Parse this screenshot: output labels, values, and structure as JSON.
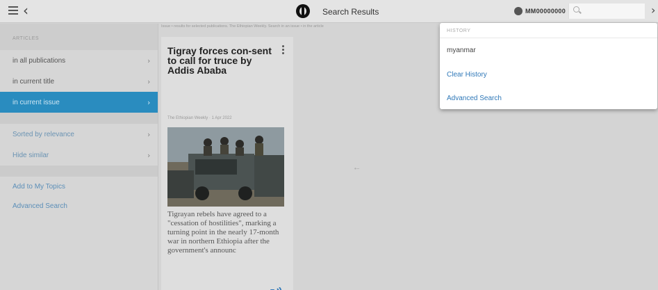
{
  "topbar": {
    "title": "Search Results",
    "user_id": "MM00000000",
    "search_value": ""
  },
  "sidebar": {
    "section_header": "ARTICLES",
    "scope_items": [
      {
        "label": "in all publications"
      },
      {
        "label": "in current title"
      },
      {
        "label": "in current issue",
        "active": true
      }
    ],
    "sort_items": [
      {
        "label": "Sorted by relevance"
      },
      {
        "label": "Hide similar"
      }
    ],
    "links": [
      {
        "label": "Add to My Topics"
      },
      {
        "label": "Advanced Search"
      }
    ]
  },
  "content": {
    "notice": "Issue • results for selected publications. The Ethiopian Weekly. Search in an issue • in the article",
    "placeholder": "•−",
    "article": {
      "title": "Tigray forces con-sent to call for truce by Addis Ababa",
      "meta": "The Ethiopian Weekly · 1 Apr 2022",
      "excerpt": "Tigrayan rebels have agreed to a \"cessation of hostilities\", marking a turning point in the nearly 17-month war in northern Ethiopia after the government's announc"
    }
  },
  "history_dropdown": {
    "header": "HISTORY",
    "items": [
      {
        "label": "myanmar"
      }
    ],
    "clear_label": "Clear History",
    "advanced_label": "Advanced Search"
  },
  "colors": {
    "accent": "#2a8cbf",
    "link": "#2f78b8",
    "overlay_bg": "#d4d4d4"
  },
  "icons": [
    "menu-icon",
    "back-arrow-icon",
    "publication-logo-icon",
    "user-icon",
    "search-icon",
    "close-icon",
    "kebab-menu-icon",
    "chevron-right-icon",
    "listen-audio-icon"
  ]
}
